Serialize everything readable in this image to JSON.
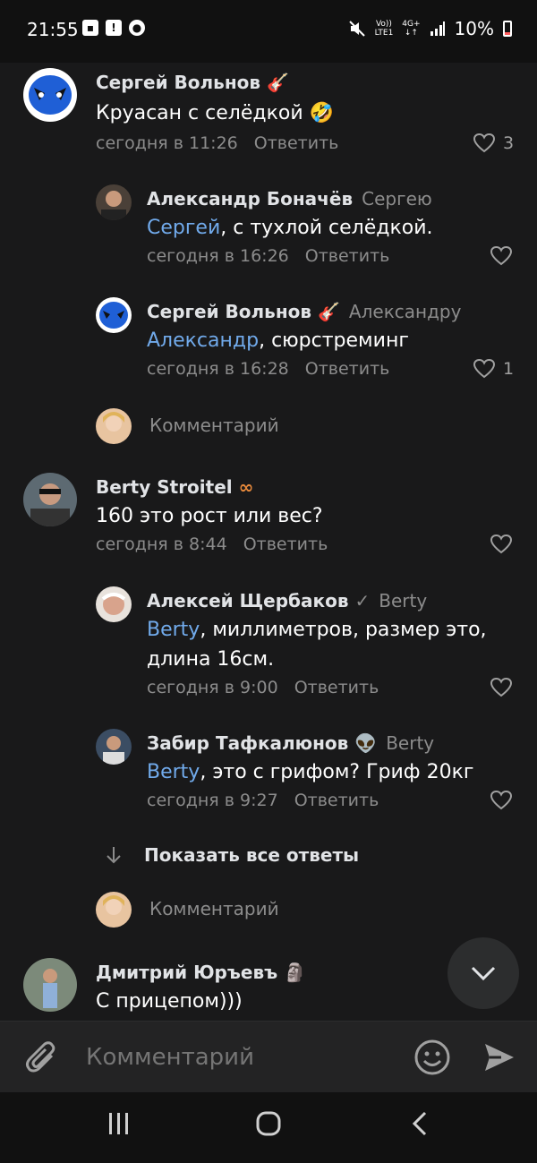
{
  "status": {
    "time": "21:55",
    "volte_top": "Vo))",
    "volte_bottom": "LTE1",
    "net_top": "4G+",
    "net_bottom": "↓↑",
    "battery": "10%"
  },
  "comments": [
    {
      "author": "Сергей Вольнов",
      "badge": "🎸",
      "text": "Круасан с селёдкой 🤣",
      "time": "сегодня в 11:26",
      "reply_label": "Ответить",
      "likes": "3"
    },
    {
      "author": "Александр Боначёв",
      "reply_to": "Сергею",
      "mention": "Сергей",
      "text": ", с тухлой селёдкой.",
      "time": "сегодня в 16:26",
      "reply_label": "Ответить"
    },
    {
      "author": "Сергей Вольнов",
      "badge": "🎸",
      "reply_to": "Александру",
      "mention": "Александр",
      "text": ", сюрстреминг",
      "time": "сегодня в 16:28",
      "reply_label": "Ответить",
      "likes": "1"
    },
    {
      "author": "Berty Stroitel",
      "badge": "∞",
      "text": "160 это рост или вес?",
      "time": "сегодня в 8:44",
      "reply_label": "Ответить"
    },
    {
      "author": "Алексей Щербаков",
      "badge": "✓",
      "reply_to": "Berty",
      "mention": "Berty",
      "text": ", миллиметров, размер это,",
      "text2": "длина 16см.",
      "time": "сегодня в 9:00",
      "reply_label": "Ответить"
    },
    {
      "author": "Забир Тафкалюнов",
      "badge": "👽",
      "reply_to": "Berty",
      "mention": "Berty",
      "text": ", это с грифом? Гриф 20кг",
      "time": "сегодня в 9:27",
      "reply_label": "Ответить"
    },
    {
      "author": "Дмитрий Юръевъ",
      "badge": "🗿",
      "text": "С прицепом)))"
    }
  ],
  "inline_placeholder_1": "Комментарий",
  "inline_placeholder_2": "Комментарий",
  "show_all_label": "Показать все ответы",
  "composer": {
    "placeholder": "Комментарий"
  },
  "colors": {
    "accent": "#71aaeb",
    "background": "#19191a"
  }
}
